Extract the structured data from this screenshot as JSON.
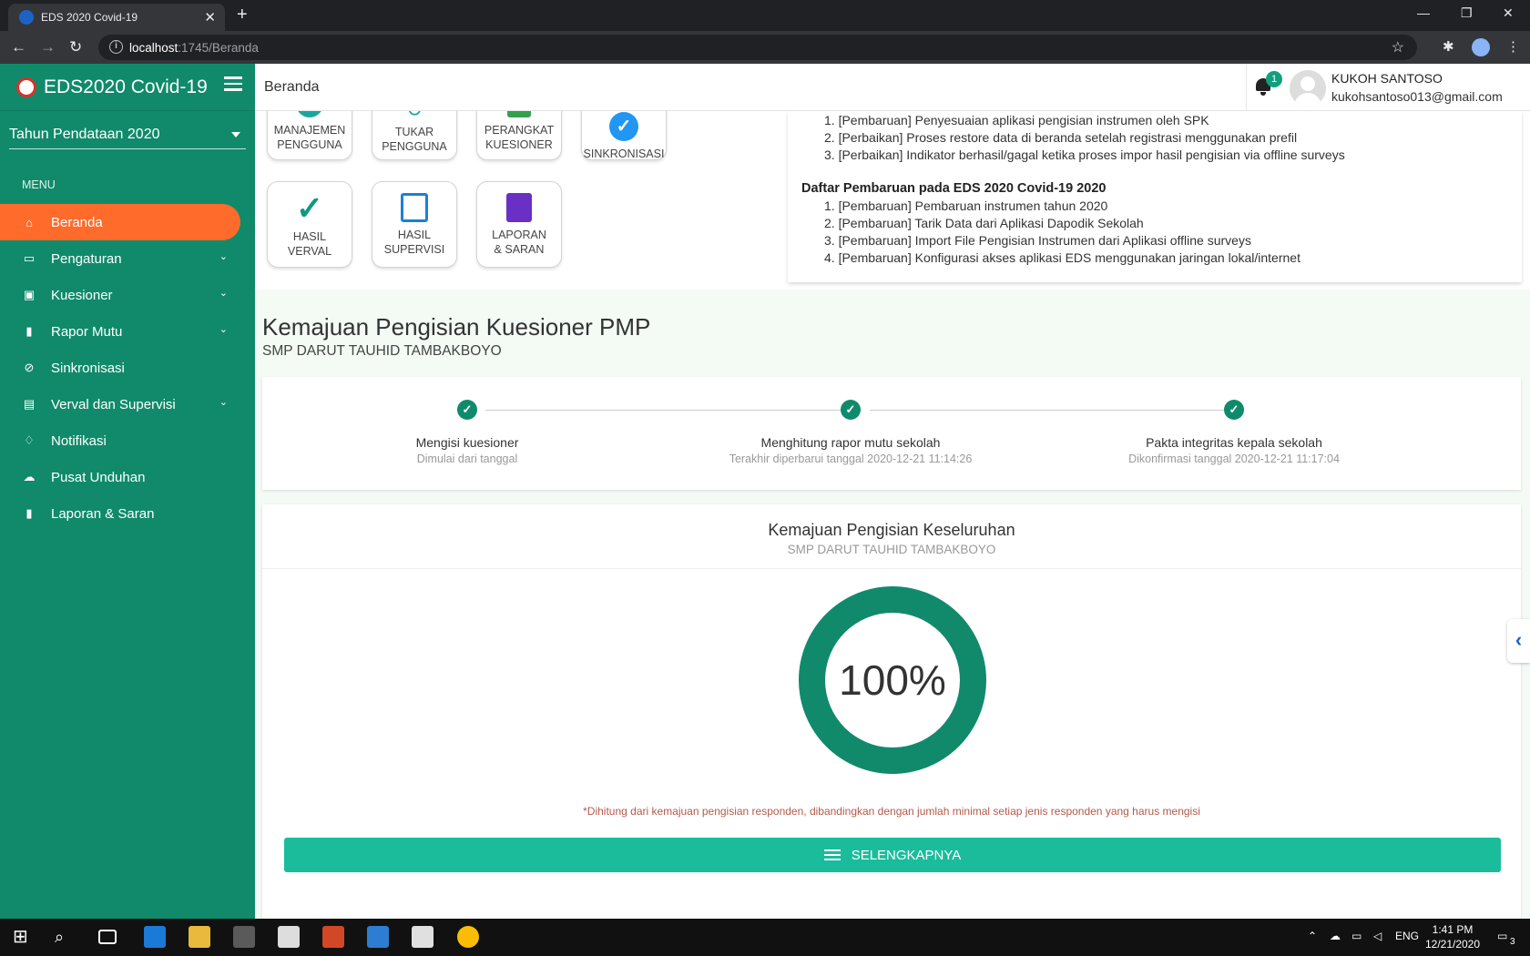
{
  "browser": {
    "tab_title": "EDS 2020 Covid-19",
    "url_host": "localhost",
    "url_path": ":1745/Beranda"
  },
  "sidebar": {
    "brand": "EDS2020 Covid-19",
    "year_select": "Tahun Pendataan 2020",
    "menu_label": "MENU",
    "items": [
      {
        "label": "Beranda",
        "icon": "home-icon",
        "active": true
      },
      {
        "label": "Pengaturan",
        "icon": "monitor-icon",
        "has_children": true
      },
      {
        "label": "Kuesioner",
        "icon": "ticket-icon",
        "has_children": true
      },
      {
        "label": "Rapor Mutu",
        "icon": "book-icon",
        "has_children": true
      },
      {
        "label": "Sinkronisasi",
        "icon": "check-circle-icon"
      },
      {
        "label": "Verval dan Supervisi",
        "icon": "document-icon",
        "has_children": true
      },
      {
        "label": "Notifikasi",
        "icon": "bell-icon"
      },
      {
        "label": "Pusat Unduhan",
        "icon": "cloud-download-icon"
      },
      {
        "label": "Laporan & Saran",
        "icon": "book-icon"
      }
    ]
  },
  "header": {
    "page_title": "Beranda",
    "notif_count": "1",
    "user_name": "KUKOH SANTOSO",
    "user_email": "kukohsantoso013@gmail.com"
  },
  "tiles": {
    "manajemen": [
      "MANAJEMEN",
      "PENGGUNA"
    ],
    "tukar": [
      "TUKAR",
      "PENGGUNA"
    ],
    "perangkat": [
      "PERANGKAT",
      "KUESIONER"
    ],
    "sinkronisasi": "SINKRONISASI",
    "hasil_verval": [
      "HASIL",
      "VERVAL"
    ],
    "hasil_supervisi": [
      "HASIL",
      "SUPERVISI"
    ],
    "laporan": [
      "LAPORAN",
      "& SARAN"
    ]
  },
  "news": {
    "list1": [
      "1. [Pembaruan] Penyesuaian aplikasi pengisian instrumen oleh SPK",
      "2. [Perbaikan] Proses restore data di beranda setelah registrasi menggunakan prefil",
      "3. [Perbaikan] Indikator berhasil/gagal ketika proses impor hasil pengisian via offline surveys"
    ],
    "heading2": "Daftar Pembaruan pada EDS 2020 Covid-19 2020",
    "list2": [
      "1. [Pembaruan] Pembaruan instrumen tahun 2020",
      "2. [Pembaruan] Tarik Data dari Aplikasi Dapodik Sekolah",
      "3. [Pembaruan] Import File Pengisian Instrumen dari Aplikasi offline surveys",
      "4. [Pembaruan] Konfigurasi akses aplikasi EDS menggunakan jaringan lokal/internet"
    ]
  },
  "progress_section": {
    "title": "Kemajuan Pengisian Kuesioner PMP",
    "school": "SMP DARUT TAUHID TAMBAKBOYO"
  },
  "steps": [
    {
      "label": "Mengisi kuesioner",
      "sub": "Dimulai dari tanggal"
    },
    {
      "label": "Menghitung rapor mutu sekolah",
      "sub": "Terakhir diperbarui tanggal 2020-12-21 11:14:26"
    },
    {
      "label": "Pakta integritas kepala sekolah",
      "sub": "Dikonfirmasi tanggal 2020-12-21 11:17:04"
    }
  ],
  "overall": {
    "title": "Kemajuan Pengisian Keseluruhan",
    "school": "SMP DARUT TAUHID TAMBAKBOYO",
    "percent_text": "100%",
    "percent_value": 100,
    "note": "*Dihitung dari kemajuan pengisian responden, dibandingkan dengan jumlah minimal setiap jenis responden yang harus mengisi",
    "button": "SELENGKAPNYA"
  },
  "taskbar": {
    "lang": "ENG",
    "time": "1:41 PM",
    "date": "12/21/2020",
    "notif": "3"
  },
  "colors": {
    "sidebar": "#108a6b",
    "active_item": "#fe6b2b",
    "button": "#1abc9c",
    "donut": "#108a6b"
  }
}
